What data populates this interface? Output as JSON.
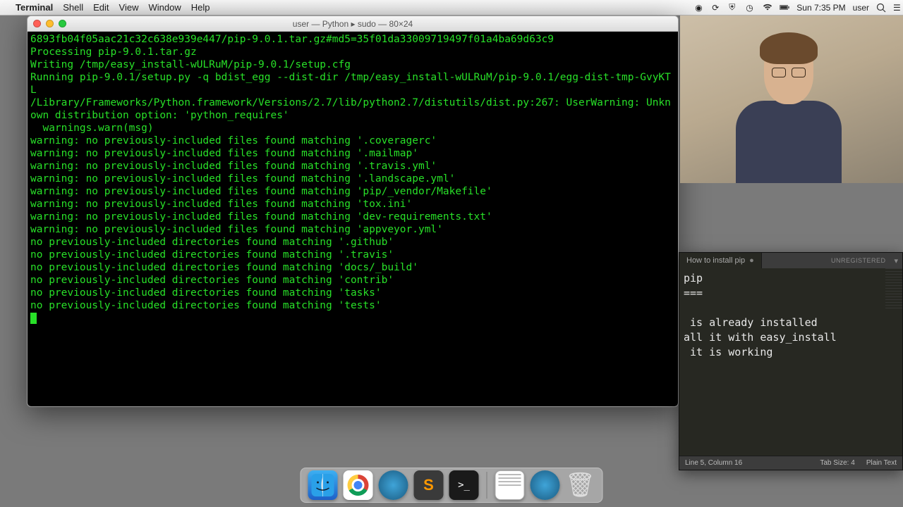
{
  "menubar": {
    "app": "Terminal",
    "items": [
      "Shell",
      "Edit",
      "View",
      "Window",
      "Help"
    ],
    "clock": "Sun 7:35 PM",
    "user": "user"
  },
  "terminal": {
    "title": "user — Python ▸ sudo — 80×24",
    "output": "6893fb04f05aac21c32c638e939e447/pip-9.0.1.tar.gz#md5=35f01da33009719497f01a4ba69d63c9\nProcessing pip-9.0.1.tar.gz\nWriting /tmp/easy_install-wULRuM/pip-9.0.1/setup.cfg\nRunning pip-9.0.1/setup.py -q bdist_egg --dist-dir /tmp/easy_install-wULRuM/pip-9.0.1/egg-dist-tmp-GvyKTL\n/Library/Frameworks/Python.framework/Versions/2.7/lib/python2.7/distutils/dist.py:267: UserWarning: Unknown distribution option: 'python_requires'\n  warnings.warn(msg)\nwarning: no previously-included files found matching '.coveragerc'\nwarning: no previously-included files found matching '.mailmap'\nwarning: no previously-included files found matching '.travis.yml'\nwarning: no previously-included files found matching '.landscape.yml'\nwarning: no previously-included files found matching 'pip/_vendor/Makefile'\nwarning: no previously-included files found matching 'tox.ini'\nwarning: no previously-included files found matching 'dev-requirements.txt'\nwarning: no previously-included files found matching 'appveyor.yml'\nno previously-included directories found matching '.github'\nno previously-included directories found matching '.travis'\nno previously-included directories found matching 'docs/_build'\nno previously-included directories found matching 'contrib'\nno previously-included directories found matching 'tasks'\nno previously-included directories found matching 'tests'"
  },
  "editor": {
    "tab": "How to install pip",
    "unregistered": "UNREGISTERED",
    "content": "pip\n===\n\n is already installed\nall it with easy_install\n it is working",
    "status_left": "Line 5, Column 16",
    "tab_size": "Tab Size: 4",
    "syntax": "Plain Text"
  },
  "dock": {
    "items": [
      "finder",
      "chrome",
      "circle-blue",
      "sublime",
      "terminal",
      "stickies",
      "circle-blue",
      "trash"
    ]
  }
}
